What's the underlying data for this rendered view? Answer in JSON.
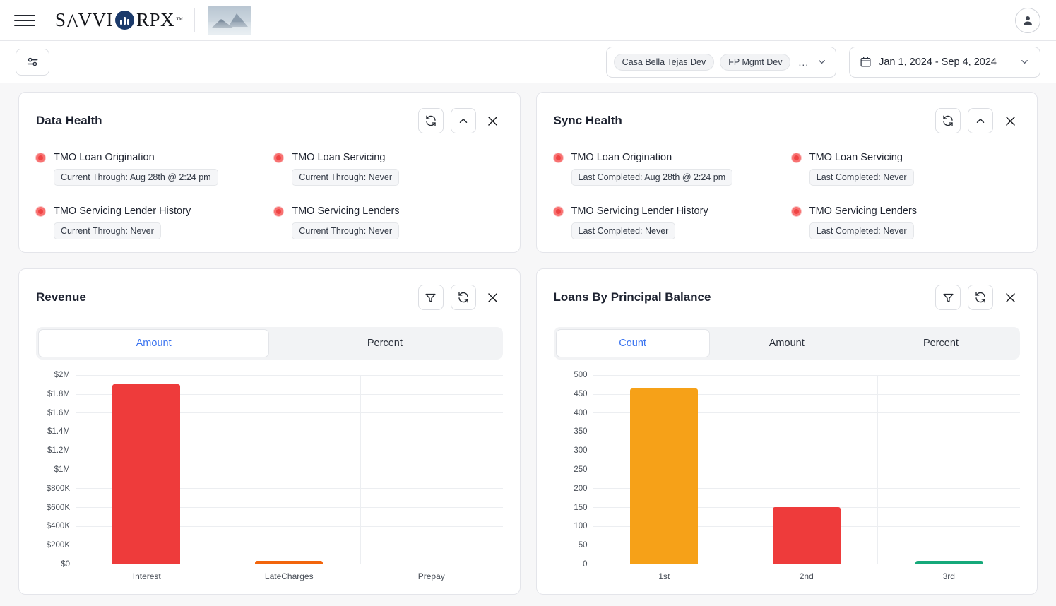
{
  "topbar": {
    "menu_icon": "hamburger-icon",
    "brand": {
      "part1": "S",
      "part2": "VVI",
      "mark": "bar-chart-circle-icon",
      "part3": "RPX",
      "tm": "™"
    },
    "thumbnail_alt": "mountain-thumbnail",
    "avatar_icon": "user-avatar-icon"
  },
  "filterbar": {
    "settings_icon": "sliders-icon",
    "entity_chips": [
      "Casa Bella Tejas Dev",
      "FP Mgmt Dev"
    ],
    "overflow_label": "...",
    "chevron_icon": "chevron-down-icon",
    "date_range": "Jan 1, 2024 - Sep 4, 2024",
    "calendar_icon": "calendar-icon"
  },
  "cards": {
    "data_health": {
      "title": "Data Health",
      "actions": [
        "refresh-icon",
        "collapse-icon",
        "close-icon"
      ],
      "items": [
        {
          "name": "TMO Loan Origination",
          "status": "red",
          "meta": "Current Through: Aug 28th @ 2:24 pm"
        },
        {
          "name": "TMO Loan Servicing",
          "status": "red",
          "meta": "Current Through: Never"
        },
        {
          "name": "TMO Servicing Lender History",
          "status": "red",
          "meta": "Current Through: Never"
        },
        {
          "name": "TMO Servicing Lenders",
          "status": "red",
          "meta": "Current Through: Never"
        }
      ]
    },
    "sync_health": {
      "title": "Sync Health",
      "actions": [
        "refresh-icon",
        "collapse-icon",
        "close-icon"
      ],
      "items": [
        {
          "name": "TMO Loan Origination",
          "status": "red",
          "meta": "Last Completed: Aug 28th @ 2:24 pm"
        },
        {
          "name": "TMO Loan Servicing",
          "status": "red",
          "meta": "Last Completed: Never"
        },
        {
          "name": "TMO Servicing Lender History",
          "status": "red",
          "meta": "Last Completed: Never"
        },
        {
          "name": "TMO Servicing Lenders",
          "status": "red",
          "meta": "Last Completed: Never"
        }
      ]
    },
    "revenue": {
      "title": "Revenue",
      "actions": [
        "filter-icon",
        "refresh-icon",
        "close-icon"
      ],
      "tabs": [
        {
          "label": "Amount",
          "active": true
        },
        {
          "label": "Percent",
          "active": false
        }
      ]
    },
    "loans_by_principal_balance": {
      "title": "Loans By Principal Balance",
      "actions": [
        "filter-icon",
        "refresh-icon",
        "close-icon"
      ],
      "tabs": [
        {
          "label": "Count",
          "active": true
        },
        {
          "label": "Amount",
          "active": false
        },
        {
          "label": "Percent",
          "active": false
        }
      ]
    }
  },
  "colors": {
    "status_red": "#ef4444",
    "accent_blue": "#3b74f0",
    "bar_red": "#ee3b3b",
    "bar_orange": "#f6a118",
    "bar_orange_dark": "#f2650c",
    "bar_green": "#16a97a"
  },
  "chart_data": [
    {
      "type": "bar",
      "title": "Revenue",
      "categories": [
        "Interest",
        "LateCharges",
        "Prepay"
      ],
      "values": [
        1900000,
        25000,
        0
      ],
      "colors": [
        "#ee3b3b",
        "#f2650c",
        "#16a97a"
      ],
      "xlabel": "",
      "ylabel": "",
      "ylim": [
        0,
        2000000
      ],
      "ytick_labels": [
        "$2M",
        "$1.8M",
        "$1.6M",
        "$1.4M",
        "$1.2M",
        "$1M",
        "$800K",
        "$600K",
        "$400K",
        "$200K",
        "$0"
      ],
      "ytick_values": [
        2000000,
        1800000,
        1600000,
        1400000,
        1200000,
        1000000,
        800000,
        600000,
        400000,
        200000,
        0
      ],
      "grid": true,
      "legend": "none"
    },
    {
      "type": "bar",
      "title": "Loans By Principal Balance",
      "categories": [
        "1st",
        "2nd",
        "3rd"
      ],
      "values": [
        465,
        150,
        5
      ],
      "colors": [
        "#f6a118",
        "#ee3b3b",
        "#16a97a"
      ],
      "xlabel": "",
      "ylabel": "",
      "ylim": [
        0,
        500
      ],
      "ytick_labels": [
        "500",
        "450",
        "400",
        "350",
        "300",
        "250",
        "200",
        "150",
        "100",
        "50",
        "0"
      ],
      "ytick_values": [
        500,
        450,
        400,
        350,
        300,
        250,
        200,
        150,
        100,
        50,
        0
      ],
      "grid": true,
      "legend": "none"
    }
  ]
}
